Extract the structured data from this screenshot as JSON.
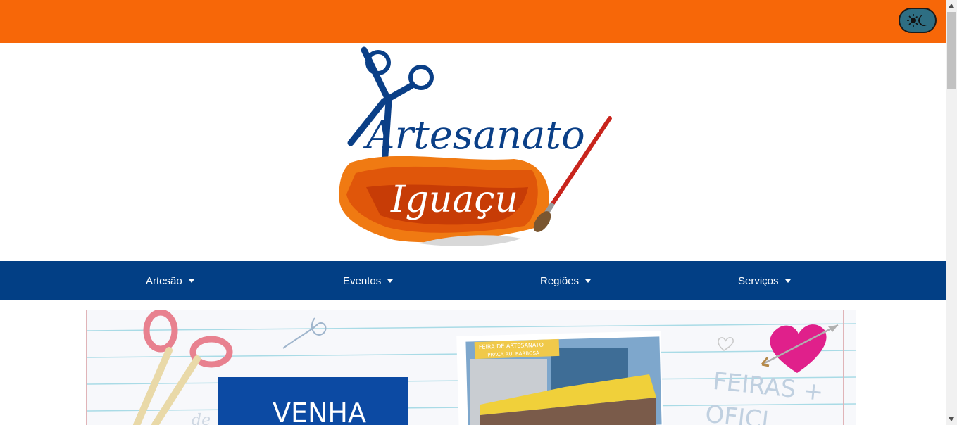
{
  "header": {
    "theme_toggle_icon": "sun-moon-icon",
    "color": "#f76708"
  },
  "logo": {
    "line1": "Artesanato",
    "line2": "Iguaçu"
  },
  "nav": {
    "color": "#023f85",
    "items": [
      {
        "label": "Artesão"
      },
      {
        "label": "Eventos"
      },
      {
        "label": "Regiões"
      },
      {
        "label": "Serviços"
      }
    ]
  },
  "banner": {
    "photo_caption_line1": "FEIRA DE ARTESANATO",
    "photo_caption_line2": "PRAÇA RUI BARBOSA",
    "headline": "VENHA",
    "side_text_line1": "FEIRAS +",
    "side_text_line2": "OFICI"
  }
}
